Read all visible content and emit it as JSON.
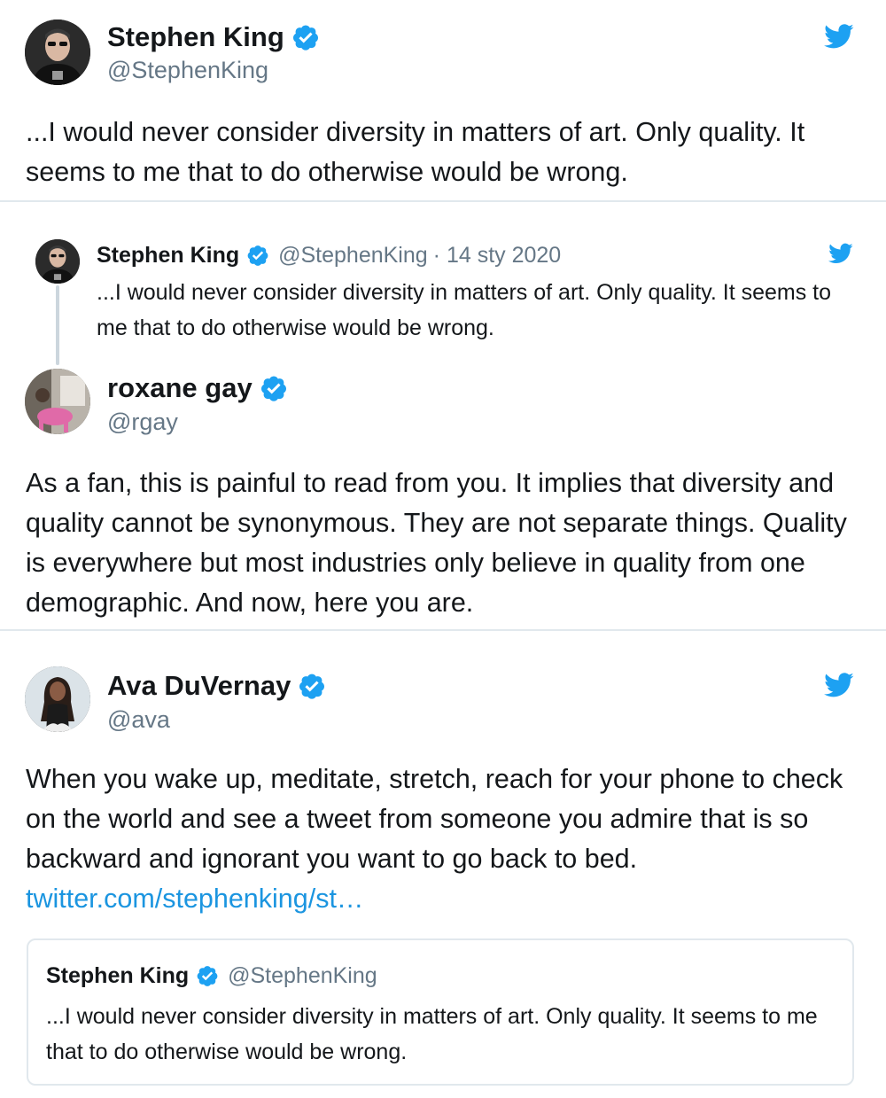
{
  "tweet1": {
    "name": "Stephen King",
    "handle": "@StephenKing",
    "text": "...I would never consider diversity in matters of art. Only quality. It seems to me that to do otherwise would be wrong.",
    "avatar_icon": "stephen-king-avatar",
    "brand_icon": "twitter-bird-icon"
  },
  "tweet2": {
    "replied_to": {
      "name": "Stephen King",
      "handle": "@StephenKing",
      "date": "· 14 sty 2020",
      "text": "...I would never consider diversity in matters of art. Only quality. It seems to me that to do otherwise would be wrong."
    },
    "name": "roxane gay",
    "handle": "@rgay",
    "text": "As a fan, this is painful to read from you. It implies that diversity and quality cannot be synonymous. They are not separate things. Quality is everywhere but most industries only believe in quality from one demographic. And now, here you are."
  },
  "tweet3": {
    "name": "Ava DuVernay",
    "handle": "@ava",
    "text": "When you wake up, meditate, stretch, reach for your phone to check on the world and see a tweet from someone you admire that is so backward and ignorant you want to go back to bed.",
    "link": "twitter.com/stephenking/st…",
    "quoted": {
      "name": "Stephen King",
      "handle": "@StephenKing",
      "text": "...I would never consider diversity in matters of art. Only quality. It seems to me that to do otherwise would be wrong."
    }
  },
  "colors": {
    "verified": "#1da1f2",
    "twitter_blue": "#1da1f2",
    "link": "#1b95e0",
    "secondary_text": "#657786",
    "divider": "#e1e8ed"
  }
}
